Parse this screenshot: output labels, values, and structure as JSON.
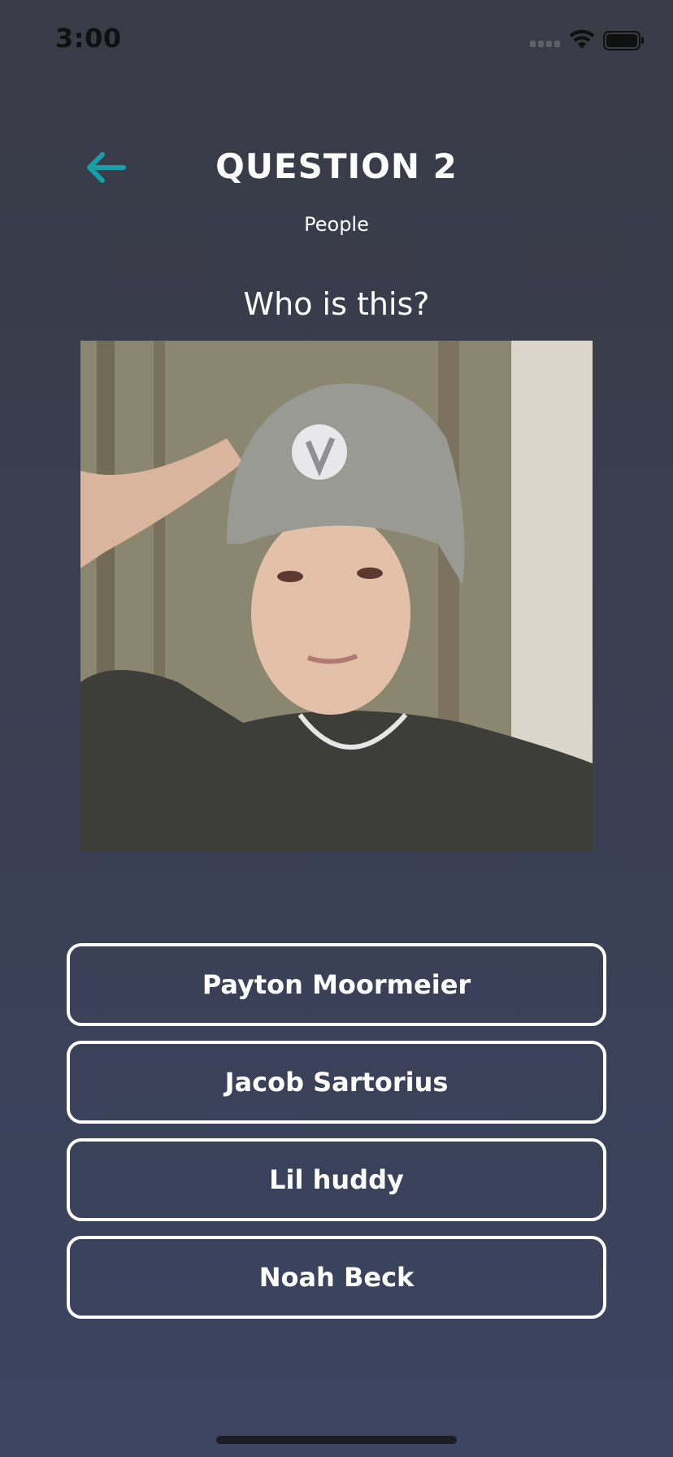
{
  "status_bar": {
    "time": "3:00",
    "icons": [
      "cellular-signal-icon",
      "wifi-icon",
      "battery-icon"
    ]
  },
  "header": {
    "back_icon": "arrow-left-icon",
    "title": "QUESTION 2",
    "category": "People"
  },
  "question": {
    "text": "Who is this?",
    "image_icon": "portrait-photo"
  },
  "answers": [
    {
      "label": "Payton Moormeier"
    },
    {
      "label": "Jacob Sartorius"
    },
    {
      "label": "Lil huddy"
    },
    {
      "label": "Noah Beck"
    }
  ],
  "colors": {
    "accent": "#159fa8",
    "background_top": "#393b46",
    "background_bottom": "#3b4461",
    "button_border": "#ffffff"
  }
}
